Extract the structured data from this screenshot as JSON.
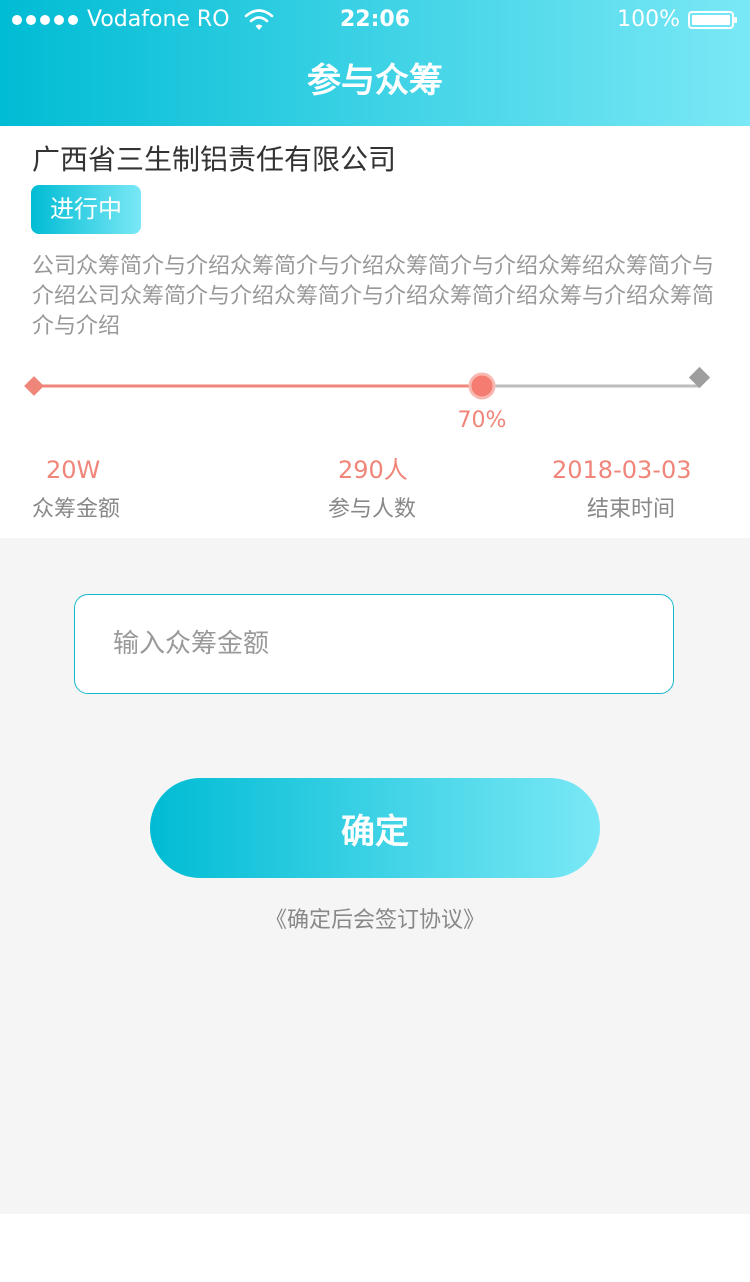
{
  "status_bar": {
    "carrier": "Vodafone RO",
    "time": "22:06",
    "battery": "100%"
  },
  "header": {
    "title": "参与众筹"
  },
  "project": {
    "company_name": "广西省三生制铝责任有限公司",
    "status": "进行中",
    "intro": "公司众筹简介与介绍众筹简介与介绍众筹简介与介绍众筹绍众筹简介与介绍公司众筹简介与介绍众筹简介与介绍众筹简介绍众筹与介绍众筹简介与介绍"
  },
  "progress": {
    "percent": 70,
    "label": "70%"
  },
  "stats": {
    "amount": {
      "value": "20W",
      "label": "众筹金额"
    },
    "participants": {
      "value": "290人",
      "label": "参与人数"
    },
    "end_date": {
      "value": "2018-03-03",
      "label": "结束时间"
    }
  },
  "form": {
    "amount_placeholder": "输入众筹金额",
    "confirm_label": "确定",
    "agreement_note": "《确定后会签订协议》"
  },
  "colors": {
    "accent_start": "#00bcd4",
    "accent_end": "#7ae8f6",
    "progress": "#f0857a"
  },
  "icons": [
    "signal-icon",
    "wifi-icon",
    "battery-icon"
  ]
}
